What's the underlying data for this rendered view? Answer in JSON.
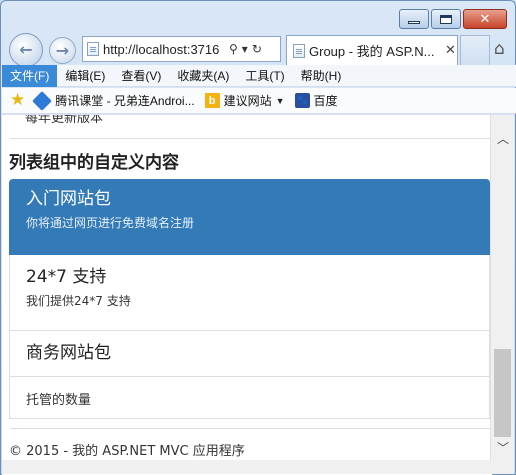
{
  "window": {
    "minimize_icon": "minimize-icon",
    "maximize_icon": "maximize-icon",
    "close_icon": "close-icon"
  },
  "navigation": {
    "address": "http://localhost:3716",
    "tab_title": "Group - 我的 ASP.N...",
    "tab_close": "✕"
  },
  "menu": {
    "items": [
      "文件(F)",
      "编辑(E)",
      "查看(V)",
      "收藏夹(A)",
      "工具(T)",
      "帮助(H)"
    ],
    "active_index": 0
  },
  "favorites": {
    "items": [
      {
        "label": "腾讯课堂 - 兄弟连Androi..."
      },
      {
        "label": "建议网站"
      },
      {
        "label": "百度"
      }
    ]
  },
  "page": {
    "cut_text": "每年更新版本",
    "section_title": "列表组中的自定义内容",
    "list_group": [
      {
        "heading": "入门网站包",
        "text": "你将通过网页进行免费域名注册"
      },
      {
        "heading": "24*7 支持",
        "text": "我们提供24*7 支持"
      },
      {
        "heading": "商务网站包"
      },
      {
        "text": "托管的数量"
      }
    ],
    "footer": "© 2015 - 我的 ASP.NET MVC 应用程序"
  },
  "colors": {
    "active_item": "#337ab7",
    "menu_active": "#3b8ad8"
  }
}
